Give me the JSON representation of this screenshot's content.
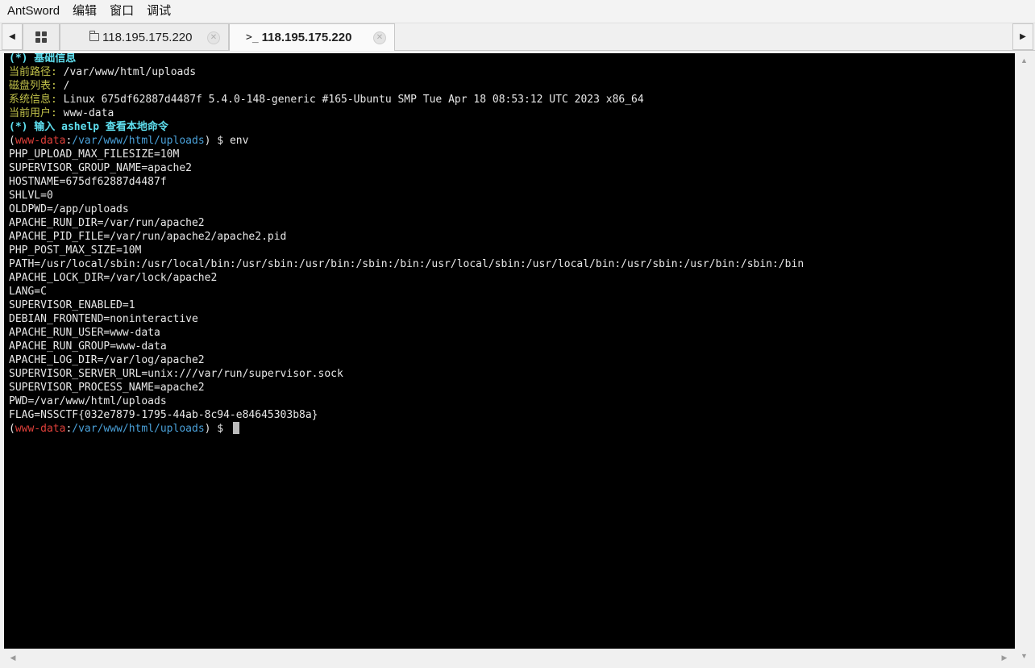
{
  "menubar": {
    "items": [
      "AntSword",
      "编辑",
      "窗口",
      "调试"
    ]
  },
  "tabs": {
    "files_label": "118.195.175.220",
    "terminal_label": "118.195.175.220",
    "terminal_prefix": ">_",
    "close_glyph": "✕",
    "left_arrow": "◀",
    "right_arrow": "▶"
  },
  "terminal": {
    "info_header": "(*) 基础信息",
    "info": [
      {
        "label": "当前路径:",
        "value": " /var/www/html/uploads"
      },
      {
        "label": "磁盘列表:",
        "value": " /"
      },
      {
        "label": "系统信息:",
        "value": " Linux 675df62887d4487f 5.4.0-148-generic #165-Ubuntu SMP Tue Apr 18 08:53:12 UTC 2023 x86_64"
      },
      {
        "label": "当前用户:",
        "value": " www-data"
      }
    ],
    "hint": "(*) 输入 ashelp 查看本地命令",
    "prompt": {
      "open": "(",
      "user": "www-data",
      "sep": ":",
      "path": "/var/www/html/uploads",
      "close": ") $ "
    },
    "command": "env",
    "output": [
      "PHP_UPLOAD_MAX_FILESIZE=10M",
      "SUPERVISOR_GROUP_NAME=apache2",
      "HOSTNAME=675df62887d4487f",
      "SHLVL=0",
      "OLDPWD=/app/uploads",
      "APACHE_RUN_DIR=/var/run/apache2",
      "APACHE_PID_FILE=/var/run/apache2/apache2.pid",
      "PHP_POST_MAX_SIZE=10M",
      "PATH=/usr/local/sbin:/usr/local/bin:/usr/sbin:/usr/bin:/sbin:/bin:/usr/local/sbin:/usr/local/bin:/usr/sbin:/usr/bin:/sbin:/bin",
      "APACHE_LOCK_DIR=/var/lock/apache2",
      "LANG=C",
      "SUPERVISOR_ENABLED=1",
      "DEBIAN_FRONTEND=noninteractive",
      "APACHE_RUN_USER=www-data",
      "APACHE_RUN_GROUP=www-data",
      "APACHE_LOG_DIR=/var/log/apache2",
      "SUPERVISOR_SERVER_URL=unix:///var/run/supervisor.sock",
      "SUPERVISOR_PROCESS_NAME=apache2",
      "PWD=/var/www/html/uploads",
      "FLAG=NSSCTF{032e7879-1795-44ab-8c94-e84645303b8a}"
    ]
  },
  "scroll": {
    "up": "▲",
    "down": "▼",
    "left": "◀",
    "right": "▶"
  },
  "colors": {
    "terminal_bg": "#000000",
    "text": "#e8e8e8",
    "header_cyan": "#5fe0f0",
    "label_yellow": "#c2c24a",
    "prompt_user_red": "#e0403a",
    "prompt_path_blue": "#4aa0d8"
  }
}
